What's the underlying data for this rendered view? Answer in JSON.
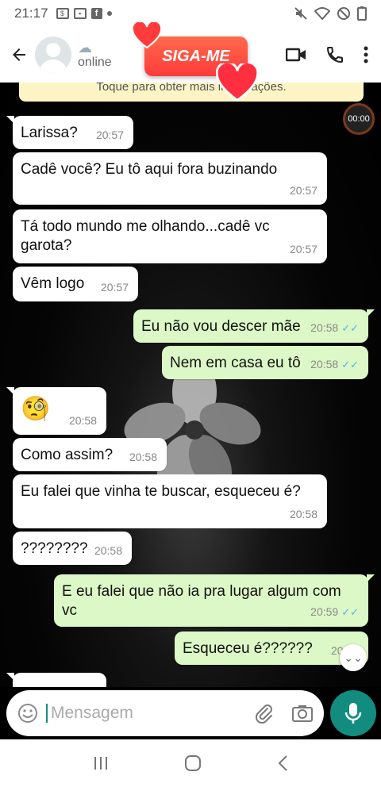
{
  "status_bar": {
    "time": "21:17"
  },
  "header": {
    "status": "online",
    "promo": "SIGA-ME"
  },
  "notice": {
    "text": "Toque para obter mais informações."
  },
  "timer": {
    "text": "00:00"
  },
  "messages": [
    {
      "dir": "in",
      "text": "Larissa?",
      "time": "20:57"
    },
    {
      "dir": "in",
      "text": "Cadê você? Eu tô aqui fora buzinando",
      "time": "20:57"
    },
    {
      "dir": "in",
      "text": "Tá todo mundo me olhando...cadê vc garota?",
      "time": "20:57"
    },
    {
      "dir": "in",
      "text": "Vêm logo",
      "time": "20:57"
    },
    {
      "dir": "out",
      "text": "Eu não vou descer mãe",
      "time": "20:58"
    },
    {
      "dir": "out",
      "text": "Nem em casa eu tô",
      "time": "20:58"
    },
    {
      "dir": "in",
      "text": "🧐",
      "time": "20:58"
    },
    {
      "dir": "in",
      "text": "Como assim?",
      "time": "20:58"
    },
    {
      "dir": "in",
      "text": "Eu falei que vinha te buscar,  esqueceu é?",
      "time": "20:58"
    },
    {
      "dir": "in",
      "text": "????????",
      "time": "20:58"
    },
    {
      "dir": "out",
      "text": "E eu falei que não ia pra lugar algum com vc",
      "time": "20:59"
    },
    {
      "dir": "out",
      "text": "Esqueceu é??????",
      "time": "20:59"
    }
  ],
  "composer": {
    "placeholder": "Mensagem"
  }
}
